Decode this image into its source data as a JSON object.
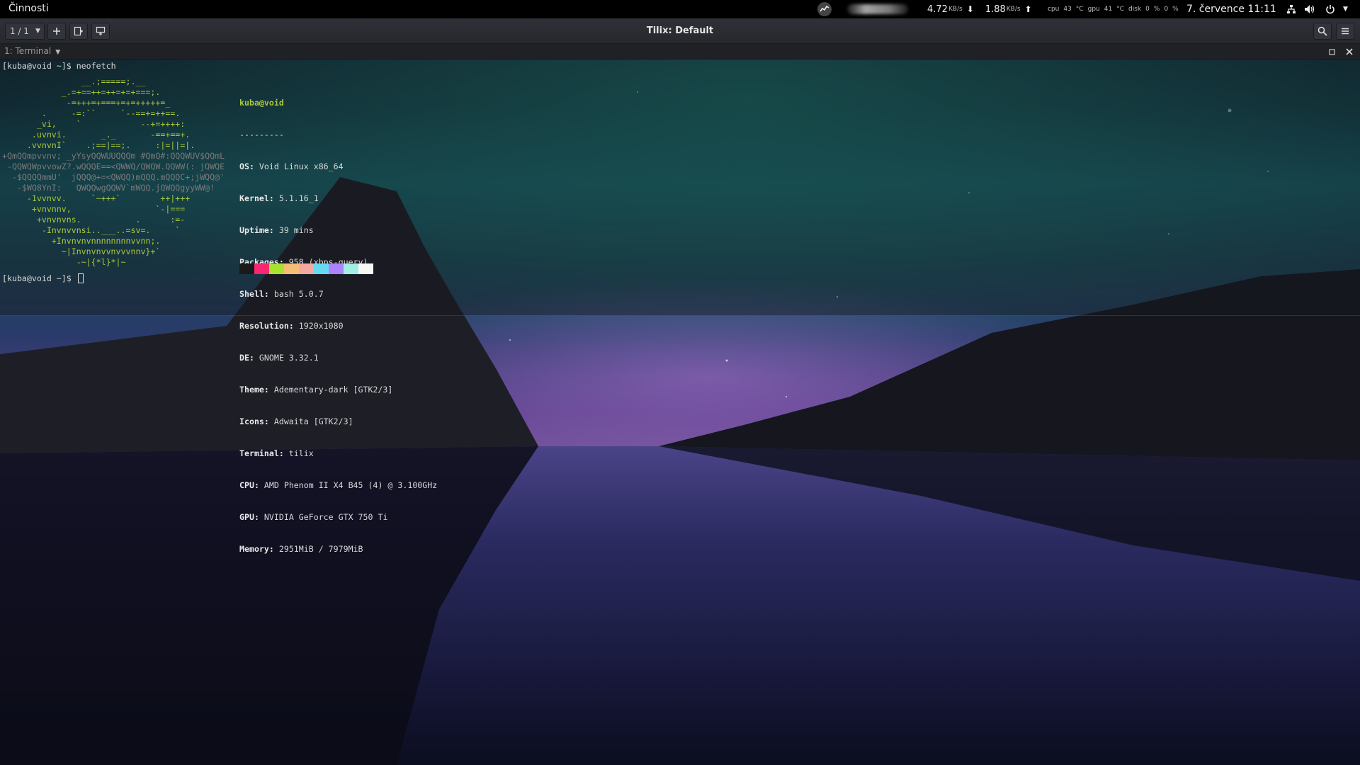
{
  "topbar": {
    "activities": "Činnosti",
    "net": {
      "down": "4.72",
      "down_unit": "KB/s",
      "up": "1.88",
      "up_unit": "KB/s"
    },
    "sensors": [
      {
        "value": "43",
        "unit": "°C",
        "label": "cpu"
      },
      {
        "value": "41",
        "unit": "°C",
        "label": "gpu"
      },
      {
        "value": "0",
        "unit": "%",
        "label": "disk"
      },
      {
        "value": "0",
        "unit": "%",
        "label": ""
      }
    ],
    "clock": "7. července  11:11"
  },
  "window": {
    "title": "Tilix: Default",
    "session_label": "1 / 1",
    "terminal_title": "1: Terminal"
  },
  "terminal": {
    "prompt": "[kuba@void ~]$ ",
    "command": "neofetch",
    "header": "kuba@void",
    "separator": "---------",
    "info": [
      {
        "key": "OS",
        "value": " Void Linux x86_64"
      },
      {
        "key": "Kernel",
        "value": " 5.1.16_1"
      },
      {
        "key": "Uptime",
        "value": " 39 mins"
      },
      {
        "key": "Packages",
        "value": " 958 (xbps-query)"
      },
      {
        "key": "Shell",
        "value": " bash 5.0.7"
      },
      {
        "key": "Resolution",
        "value": " 1920x1080"
      },
      {
        "key": "DE",
        "value": " GNOME 3.32.1"
      },
      {
        "key": "Theme",
        "value": " Adementary-dark [GTK2/3]"
      },
      {
        "key": "Icons",
        "value": " Adwaita [GTK2/3]"
      },
      {
        "key": "Terminal",
        "value": " tilix"
      },
      {
        "key": "CPU",
        "value": " AMD Phenom II X4 B45 (4) @ 3.100GHz"
      },
      {
        "key": "GPU",
        "value": " NVIDIA GeForce GTX 750 Ti"
      },
      {
        "key": "Memory",
        "value": " 2951MiB / 7979MiB"
      }
    ],
    "ascii_logo": [
      "                __.;=====;.__",
      "            _.=+==++=++=+=+===;.",
      "             -=+++=+===+=+=+++++=_",
      "        .     -=:``     `--==+=++==.",
      "       _vi,    `            --+=++++:",
      "      .uvnvi.       _._       -==+==+.",
      "     .vvnvnI`    .;==|==;.     :|=||=|.",
      "+QmQQmpvvnv; _yYsyQQWUUQQQm #QmQ#:QQQWUV$QQmL",
      " -QQWQWpvvowZ?.wQQQE==<QWWQ/QWQW.QQWW(: jQWQE",
      "  -$QQQQmmU'  jQQQ@+=<QWQQ)mQQQ.mQQQC+;jWQQ@'",
      "   -$WQ8YnI:   QWQQwgQQWV`mWQQ.jQWQQgyyWW@!",
      "     -1vvnvv.     `~+++`        ++|+++",
      "      +vnvnnv,                 `-|===",
      "       +vnvnvns.           .      :=-",
      "        -Invnvvnsi..___..=sv=.     `",
      "          +Invnvnvnnnnnnnnvvnn;.",
      "            ~|Invnvnvvnvvvnnv}+`",
      "               -~|{*l}*|~"
    ],
    "palette": [
      "#1a1a1a",
      "#f92672",
      "#a6e22e",
      "#f4bf75",
      "#f5a8a0",
      "#66d9ef",
      "#ae81ff",
      "#a1efe4",
      "#f8f8f2"
    ],
    "colors": {
      "green": "#a9c93a",
      "text": "#d8d8d8"
    }
  },
  "icons": {
    "app_indicator": "chart-app-icon",
    "network": "network-icon",
    "volume": "volume-icon",
    "power": "power-icon",
    "search": "search-icon",
    "menu": "hamburger-menu-icon",
    "add_terminal": "plus-icon",
    "add_right": "split-right-icon",
    "add_down": "split-down-icon"
  }
}
